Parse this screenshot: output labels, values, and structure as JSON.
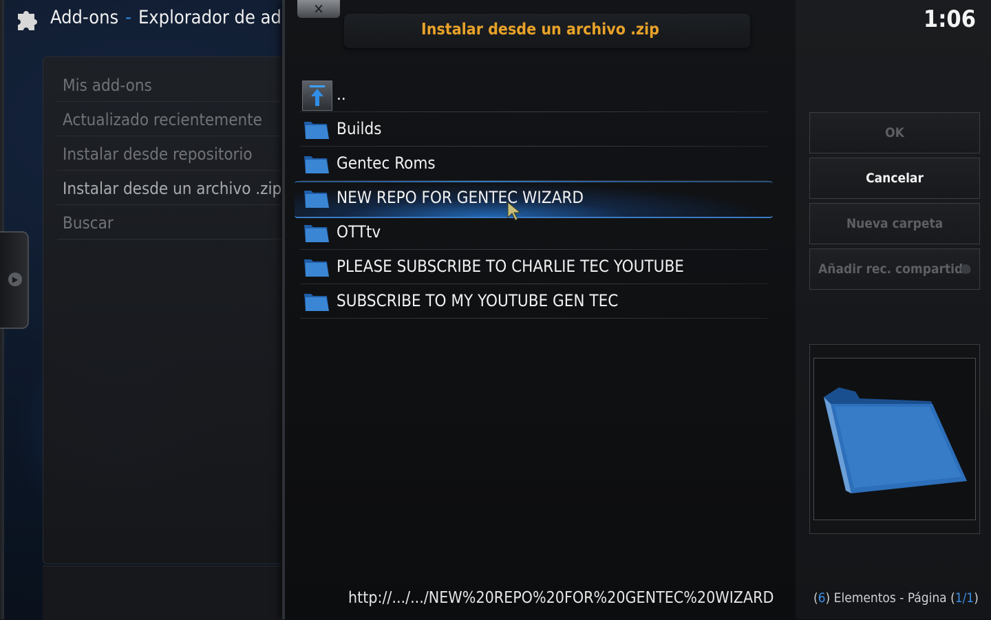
{
  "header": {
    "section": "Add-ons",
    "separator": "-",
    "subtitle": "Explorador de add-ons"
  },
  "menu": {
    "items": [
      {
        "label": "Mis add-ons"
      },
      {
        "label": "Actualizado recientemente"
      },
      {
        "label": "Instalar desde repositorio"
      },
      {
        "label": "Instalar desde un archivo .zip"
      },
      {
        "label": "Buscar"
      }
    ]
  },
  "dialog": {
    "close_label": "✕",
    "title": "Instalar desde un archivo .zip",
    "files": [
      {
        "label": "..",
        "type": "parent"
      },
      {
        "label": "Builds",
        "type": "folder"
      },
      {
        "label": "Gentec Roms",
        "type": "folder"
      },
      {
        "label": "NEW REPO FOR GENTEC WIZARD",
        "type": "folder",
        "selected": true
      },
      {
        "label": "OTTtv",
        "type": "folder"
      },
      {
        "label": "PLEASE SUBSCRIBE TO CHARLIE TEC YOUTUBE",
        "type": "folder"
      },
      {
        "label": "SUBSCRIBE TO MY YOUTUBE GEN TEC",
        "type": "folder"
      }
    ],
    "path": "http://.../.../NEW%20REPO%20FOR%20GENTEC%20WIZARD"
  },
  "sidebar": {
    "clock": "1:06",
    "buttons": {
      "ok": "OK",
      "cancel": "Cancelar",
      "new_folder": "Nueva carpeta",
      "add_share": "Añadir rec. compartido"
    },
    "status": {
      "count": "6",
      "elements_label": "Elementos - Página",
      "page": "1/1"
    }
  },
  "colors": {
    "accent_blue": "#2f8ee6",
    "title_orange": "#e8a229"
  }
}
